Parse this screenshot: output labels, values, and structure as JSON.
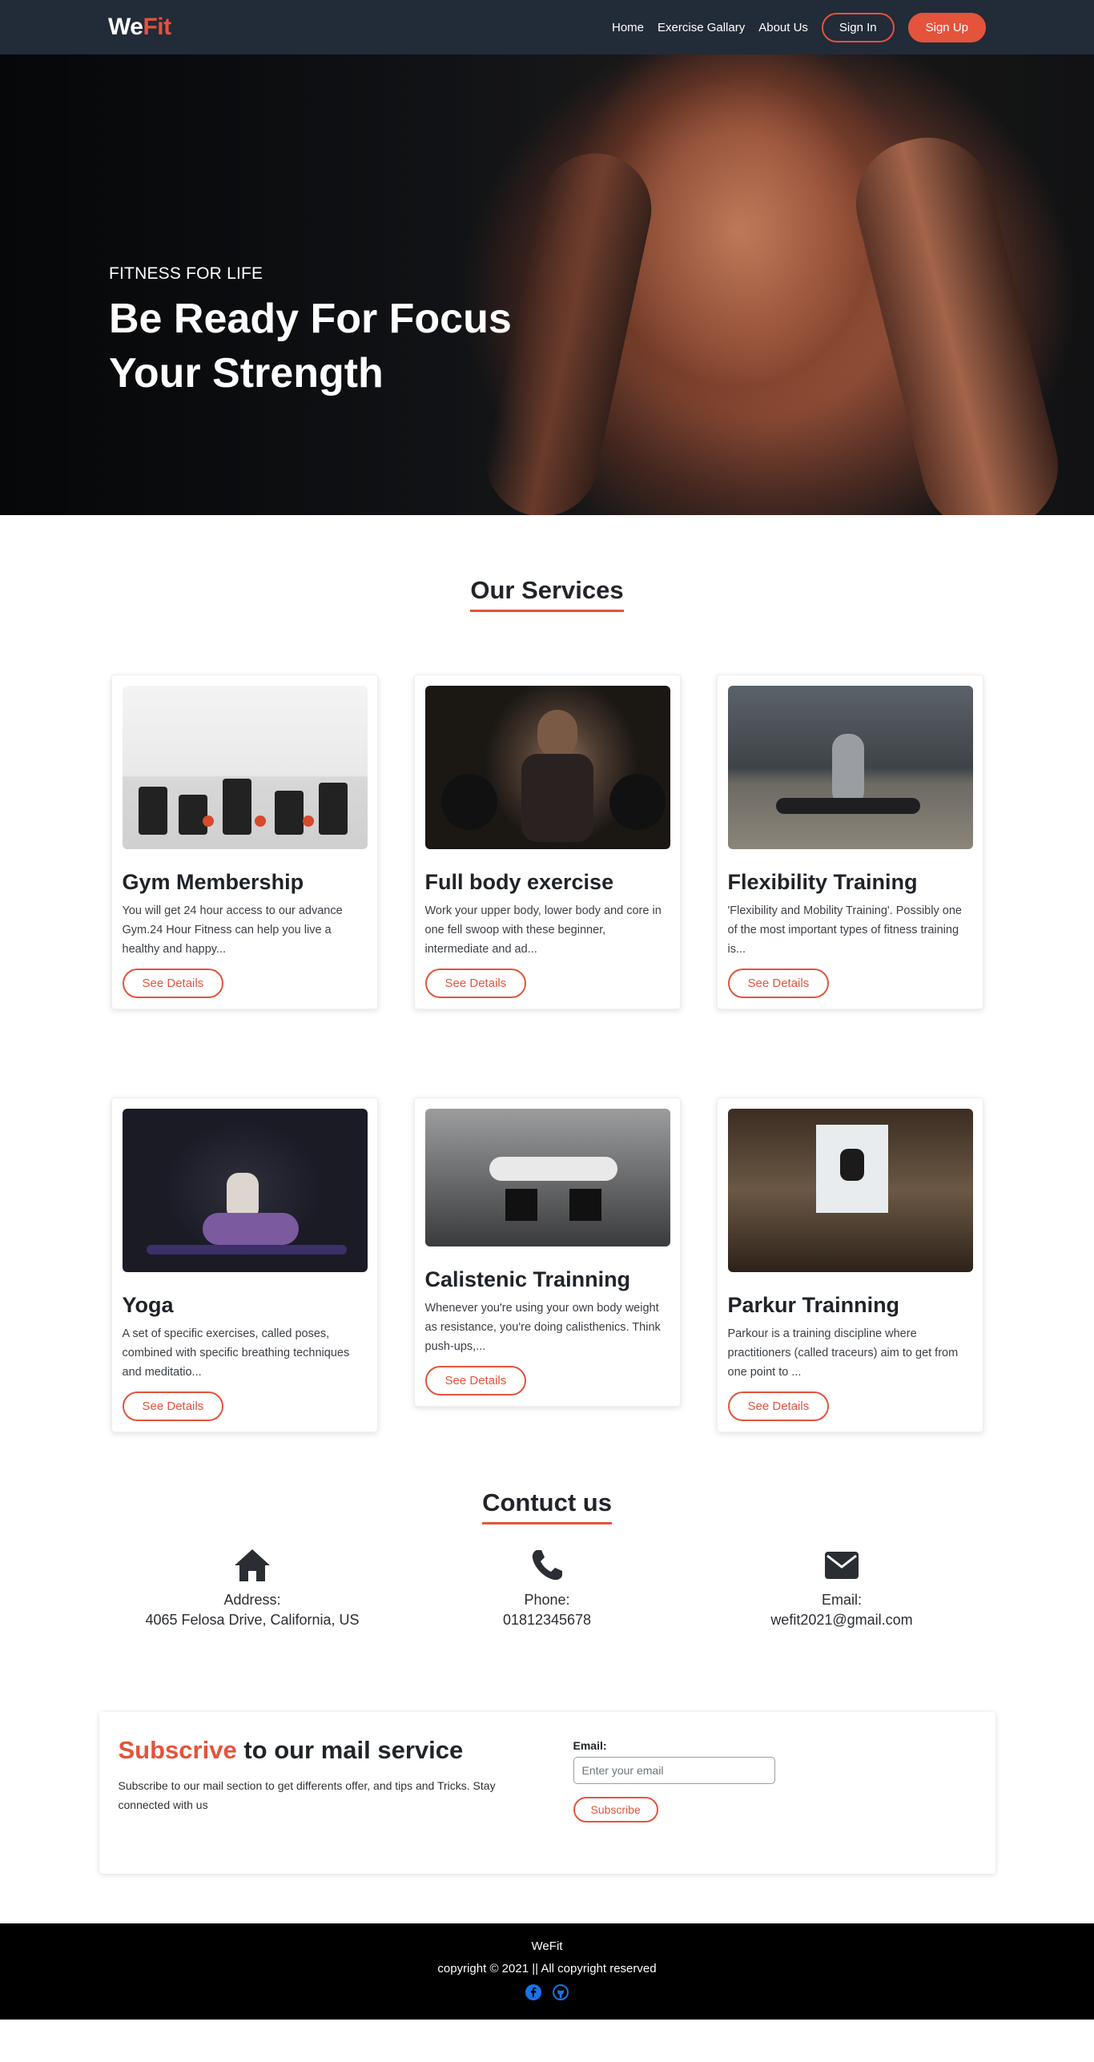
{
  "nav": {
    "logo_we": "We",
    "logo_fit": "Fit",
    "links": [
      "Home",
      "Exercise Gallary",
      "About Us"
    ],
    "signin": "Sign In",
    "signup": "Sign Up"
  },
  "hero": {
    "subtitle": "FITNESS FOR LIFE",
    "title": "Be Ready For Focus Your Strength"
  },
  "services": {
    "heading": "Our Services",
    "cards": [
      {
        "title": "Gym Membership",
        "text": "You will get 24 hour access to our advance Gym.24 Hour Fitness can help you live a healthy and happy...",
        "button": "See Details"
      },
      {
        "title": "Full body exercise",
        "text": "Work your upper body, lower body and core in one fell swoop with these beginner, intermediate and ad...",
        "button": "See Details"
      },
      {
        "title": "Flexibility Training",
        "text": "'Flexibility and Mobility Training'. Possibly one of the most important types of fitness training is...",
        "button": "See Details"
      },
      {
        "title": "Yoga",
        "text": "A set of specific exercises, called poses, combined with specific breathing techniques and meditatio...",
        "button": "See Details"
      },
      {
        "title": "Calistenic Trainning",
        "text": "Whenever you're using your own body weight as resistance, you're doing calisthenics. Think push-ups,...",
        "button": "See Details"
      },
      {
        "title": "Parkur Trainning",
        "text": "Parkour is a training discipline where practitioners (called traceurs) aim to get from one point to ...",
        "button": "See Details"
      }
    ]
  },
  "contact": {
    "heading": "Contuct us",
    "items": [
      {
        "icon": "home-icon",
        "label": "Address:",
        "value": "4065 Felosa Drive, California, US"
      },
      {
        "icon": "phone-icon",
        "label": "Phone:",
        "value": "01812345678"
      },
      {
        "icon": "envelope-icon",
        "label": "Email:",
        "value": "wefit2021@gmail.com"
      }
    ]
  },
  "subscribe": {
    "title_accent": "Subscrive",
    "title_rest": " to our mail service",
    "text": "Subscribe to our mail section to get differents offer, and tips and Tricks. Stay connected with us",
    "email_label": "Email:",
    "email_placeholder": "Enter your email",
    "button": "Subscribe"
  },
  "footer": {
    "brand": "WeFit",
    "copyright": "copyright © 2021 || All copyright reserved",
    "socials": [
      "facebook-icon",
      "github-icon"
    ]
  },
  "colors": {
    "accent": "#e4533c",
    "navbar": "#222b38",
    "footer": "#000000",
    "social": "#1a73e8"
  }
}
